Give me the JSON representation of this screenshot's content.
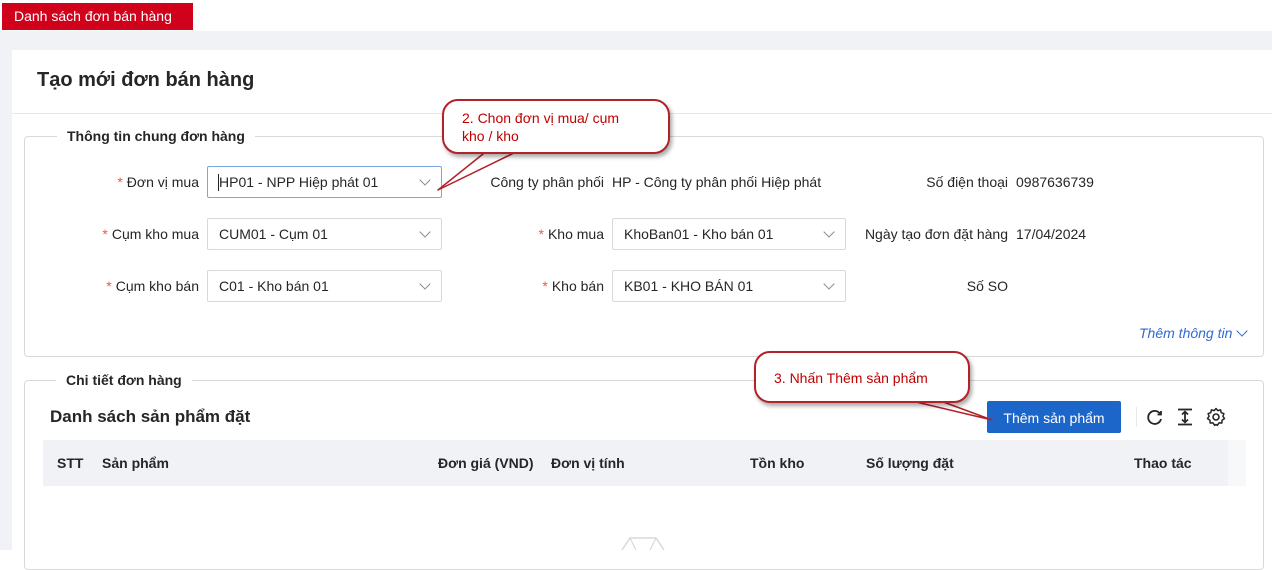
{
  "tabs": {
    "active_label": "Danh sách đơn bán hàng"
  },
  "page": {
    "title": "Tạo mới đơn bán hàng"
  },
  "general_section": {
    "legend": "Thông tin chung đơn hàng",
    "fields": {
      "buyer_unit": {
        "label": "Đơn vị mua",
        "value": "HP01 - NPP Hiệp phát 01"
      },
      "buy_cluster": {
        "label": "Cụm kho mua",
        "value": "CUM01 - Cụm 01"
      },
      "sell_cluster": {
        "label": "Cụm kho bán",
        "value": "C01 - Kho bán 01"
      },
      "buy_warehouse": {
        "label": "Kho mua",
        "value": "KhoBan01 - Kho bán 01"
      },
      "sell_warehouse": {
        "label": "Kho bán",
        "value": "KB01 - KHO BÁN 01"
      }
    },
    "info": {
      "company_label": "Công ty phân phối",
      "company_value": "HP - Công ty phân phối Hiệp phát",
      "phone_label": "Số điện thoại",
      "phone_value": "0987636739",
      "created_label": "Ngày tạo đơn đặt hàng",
      "created_value": "17/04/2024",
      "so_label": "Số SO",
      "so_value": ""
    },
    "more_link": "Thêm thông tin"
  },
  "detail_section": {
    "legend": "Chi tiết đơn hàng",
    "list_title": "Danh sách sản phẩm đặt",
    "add_button": "Thêm sản phẩm",
    "columns": [
      "STT",
      "Sản phẩm",
      "Đơn giá (VND)",
      "Đơn vị tính",
      "Tồn kho",
      "Số lượng đặt",
      "Thao tác"
    ]
  },
  "annotations": {
    "callout_2_line1": "2. Chon đơn vị mua/ cụm",
    "callout_2_line2": "kho / kho",
    "callout_3": "3. Nhấn Thêm sản phẩm"
  },
  "colors": {
    "brand_red": "#d0021b",
    "primary_blue": "#1c66c9",
    "link_blue": "#2f6bd1",
    "required": "#ff4d4f",
    "callout_border": "#b22229"
  },
  "icons": [
    "reload-icon",
    "column-height-icon",
    "settings-icon",
    "chevron-down-icon",
    "empty-box-icon"
  ]
}
